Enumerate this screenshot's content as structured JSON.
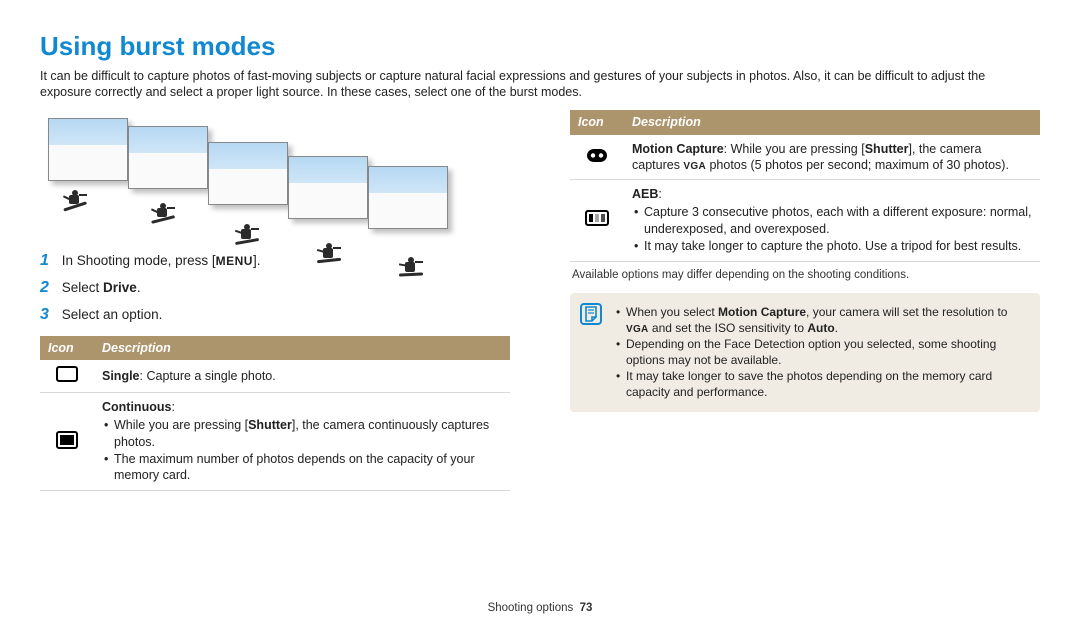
{
  "title": "Using burst modes",
  "intro": "It can be difficult to capture photos of fast-moving subjects or capture natural facial expressions and gestures of your subjects in photos. Also, it can be difficult to adjust the exposure correctly and select a proper light source. In these cases, select one of the burst modes.",
  "steps": {
    "s1_a": "In Shooting mode, press [",
    "s1_menu": "MENU",
    "s1_b": "].",
    "s2_a": "Select ",
    "s2_b": "Drive",
    "s2_c": ".",
    "s3": "Select an option."
  },
  "tableHeaders": {
    "icon": "Icon",
    "desc": "Description"
  },
  "left_rows": {
    "single_b": "Single",
    "single_t": ": Capture a single photo.",
    "cont_b": "Continuous",
    "cont_t": ":",
    "cont_l1_a": "While you are pressing [",
    "cont_l1_b": "Shutter",
    "cont_l1_c": "], the camera continuously captures photos.",
    "cont_l2": "The maximum number of photos depends on the capacity of your memory card."
  },
  "right_rows": {
    "mc_b": "Motion Capture",
    "mc_t1": ": While you are pressing [",
    "mc_t1b": "Shutter",
    "mc_t1c": "], the camera captures ",
    "mc_vga": "VGA",
    "mc_t2": " photos (5 photos per second; maximum of 30 photos).",
    "aeb_b": "AEB",
    "aeb_t": ":",
    "aeb_l1": "Capture 3 consecutive photos, each with a different exposure: normal, underexposed, and overexposed.",
    "aeb_l2": "It may take longer to capture the photo. Use a tripod for best results."
  },
  "noteCaption": "Available options may differ depending on the shooting conditions.",
  "noteBox": {
    "n1a": "When you select ",
    "n1b": "Motion Capture",
    "n1c": ", your camera will set the resolution to ",
    "n1vga": "VGA",
    "n1d": " and set the ISO sensitivity to ",
    "n1e": "Auto",
    "n1f": ".",
    "n2": "Depending on the Face Detection option you selected, some shooting options may not be available.",
    "n3": "It may take longer to save the photos depending on the memory card capacity and performance."
  },
  "footer": {
    "section": "Shooting options",
    "page": "73"
  }
}
